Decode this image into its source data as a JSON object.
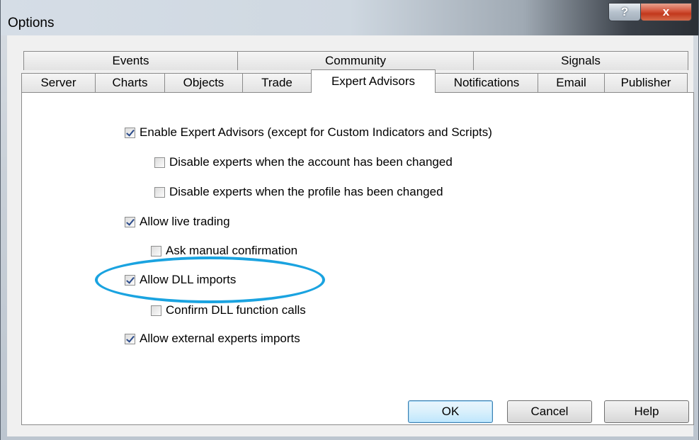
{
  "window": {
    "title": "Options",
    "help_glyph": "?",
    "close_glyph": "x"
  },
  "tabs_row1": [
    {
      "label": "Events"
    },
    {
      "label": "Community"
    },
    {
      "label": "Signals"
    }
  ],
  "tabs_row2": [
    {
      "label": "Server"
    },
    {
      "label": "Charts"
    },
    {
      "label": "Objects"
    },
    {
      "label": "Trade"
    },
    {
      "label": "Expert Advisors",
      "active": true
    },
    {
      "label": "Notifications"
    },
    {
      "label": "Email"
    },
    {
      "label": "Publisher"
    }
  ],
  "options": [
    {
      "label": "Enable Expert Advisors (except for Custom Indicators and Scripts)",
      "checked": true
    },
    {
      "label": "Disable experts when the account has been changed",
      "checked": false
    },
    {
      "label": "Disable experts when the profile has been changed",
      "checked": false
    },
    {
      "label": "Allow live trading",
      "checked": true
    },
    {
      "label": "Ask manual confirmation",
      "checked": false
    },
    {
      "label": "Allow DLL imports",
      "checked": true
    },
    {
      "label": "Confirm DLL function calls",
      "checked": false
    },
    {
      "label": "Allow external experts imports",
      "checked": true
    }
  ],
  "buttons": {
    "ok": "OK",
    "cancel": "Cancel",
    "help": "Help"
  },
  "colors": {
    "highlight_ellipse": "#1aa3e0",
    "close_button": "#c2381c"
  }
}
